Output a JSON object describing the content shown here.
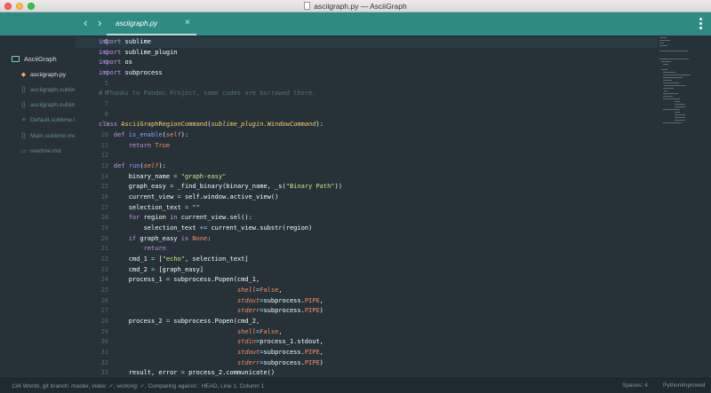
{
  "window": {
    "title": "asciigraph.py — AsciiGraph"
  },
  "tabbar": {
    "nav_back": "‹",
    "nav_forward": "›",
    "active_tab": "asciigraph.py",
    "close_glyph": "×"
  },
  "sidebar": {
    "project": "AsciiGraph",
    "files": [
      {
        "label": "asciigraph.py",
        "icon": "python-file-icon",
        "glyph": "◆",
        "active": true
      },
      {
        "label": "asciigraph.sublime-commands",
        "icon": "json-brace-icon",
        "glyph": "{}",
        "active": false
      },
      {
        "label": "asciigraph.sublime-settings",
        "icon": "json-brace-icon",
        "glyph": "{}",
        "active": false
      },
      {
        "label": "Default.sublime-keymap",
        "icon": "keymap-icon",
        "glyph": "≡",
        "active": false
      },
      {
        "label": "Main.sublime-menu",
        "icon": "json-brace-icon",
        "glyph": "{}",
        "active": false
      },
      {
        "label": "readme.md",
        "icon": "markdown-icon",
        "glyph": "▭",
        "active": false
      }
    ]
  },
  "editor": {
    "current_line": 1,
    "lines": [
      "import sublime",
      "import sublime_plugin",
      "import os",
      "import subprocess",
      "",
      "# Thanks to Pandoc Project, some codes are borrowed there.",
      "",
      "",
      "class AsciiGraphRegionCommand(sublime_plugin.WindowCommand):",
      "    def is_enable(self):",
      "        return True",
      "",
      "    def run(self):",
      "        binary_name = \"graph-easy\"",
      "        graph_easy = _find_binary(binary_name, _s(\"Binary Path\"))",
      "        current_view = self.window.active_view()",
      "        selection_text = \"\"",
      "        for region in current_view.sel():",
      "            selection_text += current_view.substr(region)",
      "        if graph_easy is None:",
      "            return",
      "        cmd_1 = [\"echo\", selection_text]",
      "        cmd_2 = [graph_easy]",
      "        process_1 = subprocess.Popen(cmd_1,",
      "                                     shell=False,",
      "                                     stdout=subprocess.PIPE,",
      "                                     stderr=subprocess.PIPE)",
      "        process_2 = subprocess.Popen(cmd_2,",
      "                                     shell=False,",
      "                                     stdin=process_1.stdout,",
      "                                     stdout=subprocess.PIPE,",
      "                                     stderr=subprocess.PIPE)",
      "        result, error = process_2.communicate()"
    ]
  },
  "status": {
    "left": "134 Words, git branch: master, index: ✓, working: ✓, Comparing against : HEAD, Line 1, Column 1",
    "spaces": "Spaces: 4",
    "syntax": "PythonImproved"
  },
  "colors": {
    "accent": "#2e8b84",
    "background": "#263238",
    "keyword": "#c792ea",
    "string": "#c3e88d",
    "function": "#82aaff",
    "class": "#ffcb6b",
    "comment": "#546e7a",
    "constant": "#f78c6c"
  }
}
